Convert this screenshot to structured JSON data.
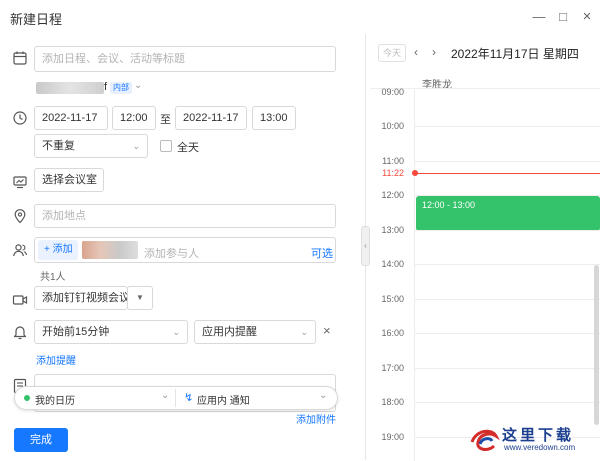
{
  "window": {
    "title": "新建日程",
    "controls": [
      "minimize-icon",
      "maximize-icon",
      "close-icon"
    ]
  },
  "form": {
    "title_placeholder": "添加日程、会议、活动等标题",
    "organizer_suffix": "f",
    "organizer_badge": "内部",
    "start_date": "2022-11-17",
    "start_time": "12:00",
    "to_label": "至",
    "end_date": "2022-11-17",
    "end_time": "13:00",
    "repeat_value": "不重复",
    "all_day_label": "全天",
    "room_button": "选择会议室",
    "location_placeholder": "添加地点",
    "add_participant_button": "+ 添加",
    "participant_placeholder": "添加参与人",
    "optional_link": "可选",
    "participant_count": "共1人",
    "video_meeting_button": "添加钉钉视频会议",
    "reminder_time": "开始前15分钟",
    "reminder_type": "应用内提醒",
    "add_reminder_link": "添加提醒",
    "attachment_link": "添加附件",
    "calendar_select": "我的日历",
    "notify_select": "应用内 通知",
    "done_button": "完成"
  },
  "calendar": {
    "today_button": "今天",
    "date_title": "2022年11月17日 星期四",
    "person": "李胜龙",
    "hours": [
      "09:00",
      "10:00",
      "11:00",
      "12:00",
      "13:00",
      "14:00",
      "15:00",
      "16:00",
      "17:00",
      "18:00",
      "19:00"
    ],
    "now_label": "11:22",
    "event_label": "12:00 - 13:00",
    "colors": {
      "now": "#f5483c",
      "event": "#34c26a",
      "accent": "#1677ff"
    }
  },
  "watermark": {
    "text": "这里下载",
    "url": "www.veredown.com"
  }
}
